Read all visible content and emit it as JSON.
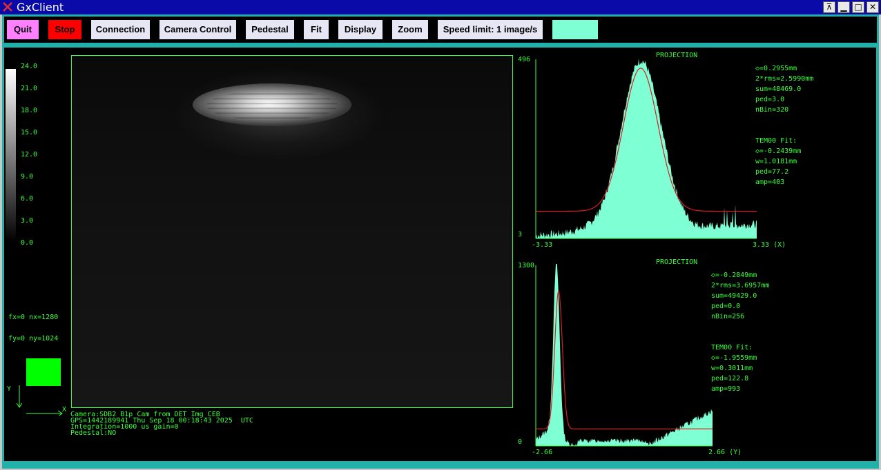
{
  "window": {
    "title": "GxClient",
    "controls": [
      "pin",
      "minimize",
      "maximize",
      "close"
    ]
  },
  "toolbar": {
    "quit": "Quit",
    "stop": "Stop",
    "connection": "Connection",
    "camera_control": "Camera Control",
    "pedestal": "Pedestal",
    "fit": "Fit",
    "display": "Display",
    "zoom": "Zoom",
    "speed_limit": "Speed limit: 1 image/s",
    "status_color": "#7fffd4"
  },
  "colors": {
    "accent_green": "#3cff3c",
    "histogram_fill": "#7fffd4",
    "fit_curve": "#d81e1e",
    "quit_bg": "#ff80ff",
    "stop_bg": "#ff0000"
  },
  "colorbar": {
    "labels": [
      "24.0",
      "21.0",
      "18.0",
      "15.0",
      "12.0",
      "9.0",
      "6.0",
      "3.0",
      "0.0"
    ]
  },
  "image_info": {
    "fx": "fx=0 nx=1280",
    "fy": "fy=0 ny=1024"
  },
  "axes": {
    "x": "X",
    "y": "Y"
  },
  "camera_info": [
    "Camera:SDB2_B1p_Cam from DET_Img_CEB",
    "GPS=1442189941 Thu Sep 18 00:18:43 2025  UTC",
    "Integration=1000 us gain=0",
    "Pedestal:NO"
  ],
  "proj_x": {
    "title": "PROJECTION",
    "ymax": "496",
    "ymin": "3",
    "xmin": "-3.33",
    "xmax": "3.33 (X)",
    "stats": [
      "◇=0.2955mm",
      "2*rms=2.5990mm",
      "sum=48469.0",
      "ped=3.0",
      "nBin=320"
    ],
    "fit": [
      "TEM00 Fit:",
      "◇=-0.2439mm",
      "w=1.0181mm",
      "ped=77.2",
      "amp=403"
    ]
  },
  "proj_y": {
    "title": "PROJECTION",
    "ymax": "1300",
    "ymin": "0",
    "xmin": "-2.66",
    "xmax": "2.66 (Y)",
    "stats": [
      "◇=-0.2849mm",
      "2*rms=3.6957mm",
      "sum=49429.0",
      "ped=0.0",
      "nBin=256"
    ],
    "fit": [
      "TEM00 Fit:",
      "◇=-1.9559mm",
      "w=0.3011mm",
      "ped=122.8",
      "amp=993"
    ]
  }
}
